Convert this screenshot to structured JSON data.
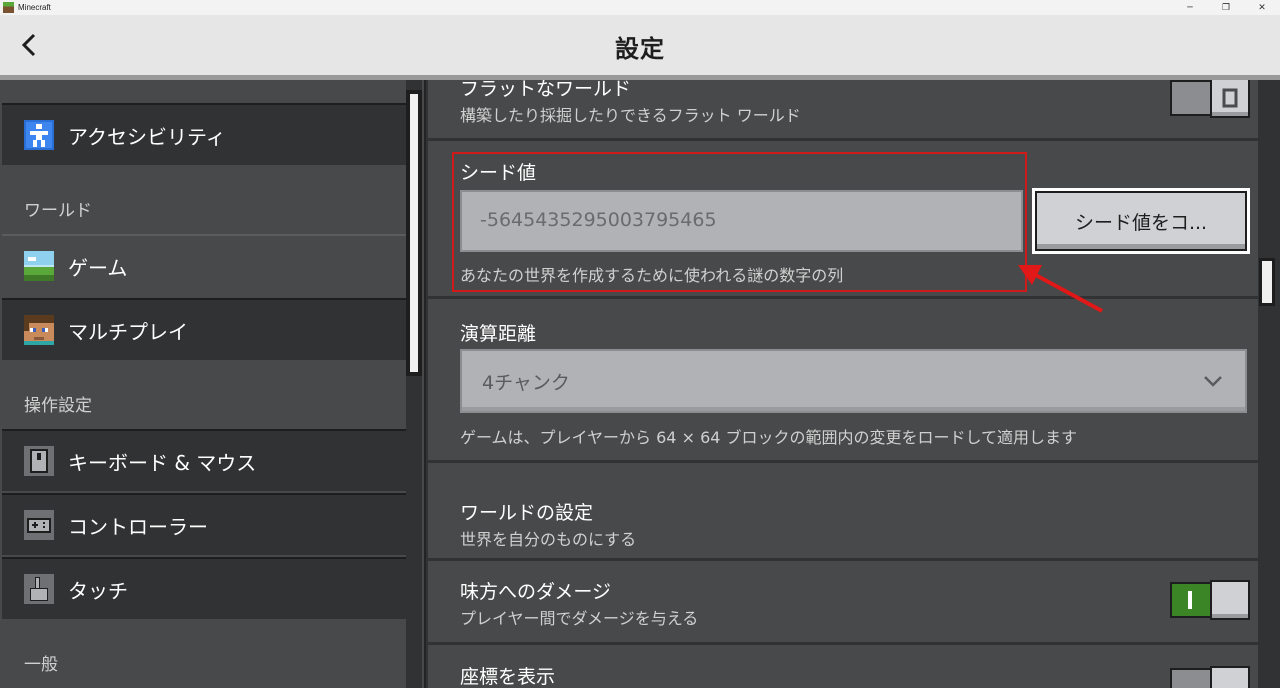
{
  "window": {
    "title": "Minecraft",
    "controls": [
      "─",
      "❐",
      "✕"
    ]
  },
  "header": {
    "title": "設定",
    "back_icon": "chevron-left-icon"
  },
  "sidebar": {
    "items": [
      {
        "label": "アクセシビリティ",
        "icon": "accessibility-icon",
        "section": ""
      },
      {
        "label": "ゲーム",
        "icon": "landscape-icon",
        "active": true
      },
      {
        "label": "マルチプレイ",
        "icon": "player-head-icon"
      },
      {
        "label": "キーボード & マウス",
        "icon": "mouse-icon"
      },
      {
        "label": "コントローラー",
        "icon": "gamepad-icon"
      },
      {
        "label": "タッチ",
        "icon": "touch-hand-icon"
      }
    ],
    "sections": [
      "ワールド",
      "操作設定",
      "一般"
    ]
  },
  "main": {
    "flat_world": {
      "title": "フラットなワールド",
      "desc": "構築したり採掘したりできるフラット ワールド",
      "on": false
    },
    "seed": {
      "title": "シード値",
      "value": "-5645435295003795465",
      "copy_label": "シード値をコ...",
      "desc": "あなたの世界を作成するために使われる謎の数字の列"
    },
    "sim_distance": {
      "title": "演算距離",
      "value": "4チャンク",
      "desc": "ゲームは、プレイヤーから 64 × 64 ブロックの範囲内の変更をロードして適用します"
    },
    "world_settings": {
      "title": "ワールドの設定",
      "desc": "世界を自分のものにする"
    },
    "friendly_fire": {
      "title": "味方へのダメージ",
      "desc": "プレイヤー間でダメージを与える",
      "on": true
    },
    "show_coords": {
      "title": "座標を表示",
      "on": false
    }
  },
  "colors": {
    "highlight": "#d01a1a",
    "toggle_on": "#3c8527"
  }
}
